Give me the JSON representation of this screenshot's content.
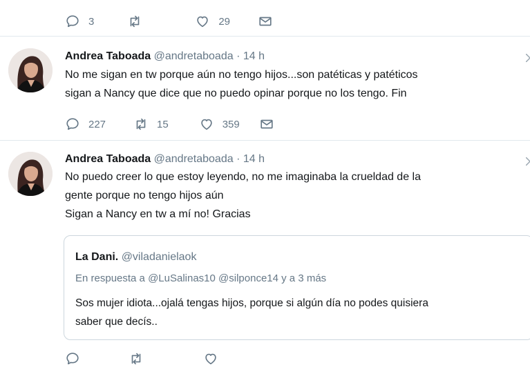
{
  "top_tweet": {
    "reply_count": "3",
    "like_count": "29"
  },
  "tweets": [
    {
      "name": "Andrea Taboada",
      "handle": "@andretaboada",
      "separator": "·",
      "time": "14 h",
      "lines": [
        "No me sigan en tw porque aún no tengo hijos...son patéticas y patéticos",
        "sigan a Nancy que dice que no puedo opinar porque no los tengo. Fin"
      ],
      "reply_count": "227",
      "retweet_count": "15",
      "like_count": "359"
    },
    {
      "name": "Andrea Taboada",
      "handle": "@andretaboada",
      "separator": "·",
      "time": "14 h",
      "lines": [
        "No puedo creer lo que estoy leyendo, no me imaginaba la crueldad de la",
        "gente porque no tengo hijos aún",
        "Sigan a Nancy en tw a mí no! Gracias"
      ],
      "quoted": {
        "name": "La Dani.",
        "handle": "@viladanielaok",
        "reply_to": "En respuesta a @LuSalinas10 @silponce14 y a 3 más",
        "lines": [
          "Sos mujer idiota...ojalá tengas hijos, porque si algún día no podes quisiera",
          "saber que decís.."
        ]
      }
    }
  ],
  "icons": {
    "reply": "reply-icon",
    "retweet": "retweet-icon",
    "like": "heart-icon",
    "dm": "envelope-icon"
  },
  "colors": {
    "text": "#14171a",
    "secondary": "#657786",
    "border": "#e1e8ed"
  }
}
